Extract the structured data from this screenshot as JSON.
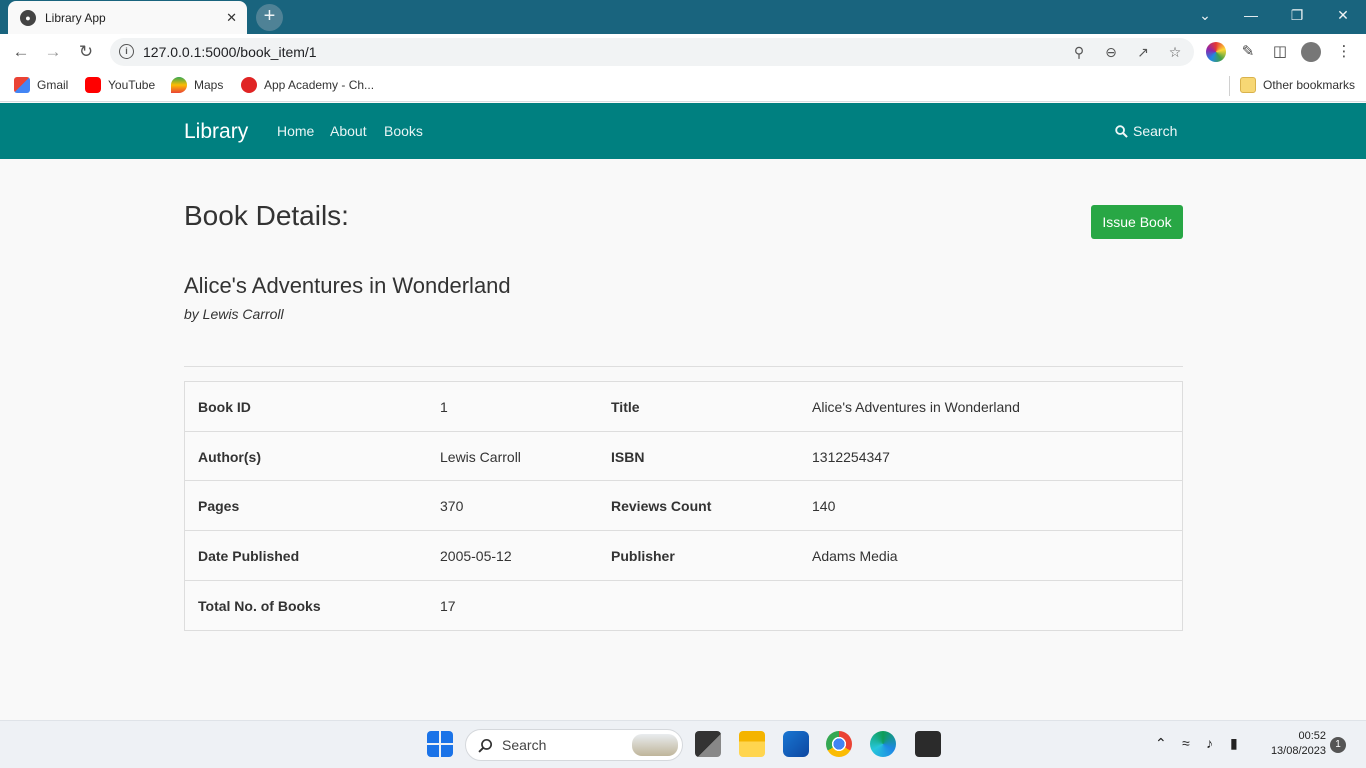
{
  "browser": {
    "tab_title": "Library App",
    "url": "127.0.0.1:5000/book_item/1",
    "bookmarks": [
      "Gmail",
      "YouTube",
      "Maps",
      "App Academy - Ch..."
    ],
    "other_bookmarks": "Other bookmarks"
  },
  "navbar": {
    "brand": "Library",
    "links": [
      "Home",
      "About",
      "Books"
    ],
    "search": "Search",
    "bg_color": "#008080"
  },
  "page": {
    "heading": "Book Details:",
    "issue_button": "Issue Book",
    "book_title": "Alice's Adventures in Wonderland",
    "book_author": "by Lewis Carroll",
    "button_color": "#28a745"
  },
  "details": [
    {
      "label1": "Book ID",
      "value1": "1",
      "label2": "Title",
      "value2": "Alice's Adventures in Wonderland"
    },
    {
      "label1": "Author(s)",
      "value1": "Lewis Carroll",
      "label2": "ISBN",
      "value2": "1312254347"
    },
    {
      "label1": "Pages",
      "value1": "370",
      "label2": "Reviews Count",
      "value2": "140"
    },
    {
      "label1": "Date Published",
      "value1": "2005-05-12",
      "label2": "Publisher",
      "value2": "Adams Media"
    },
    {
      "label1": "Total No. of Books",
      "value1": "17",
      "label2": "",
      "value2": ""
    }
  ],
  "taskbar": {
    "search": "Search",
    "time": "00:52",
    "date": "13/08/2023",
    "notifications": "1"
  }
}
